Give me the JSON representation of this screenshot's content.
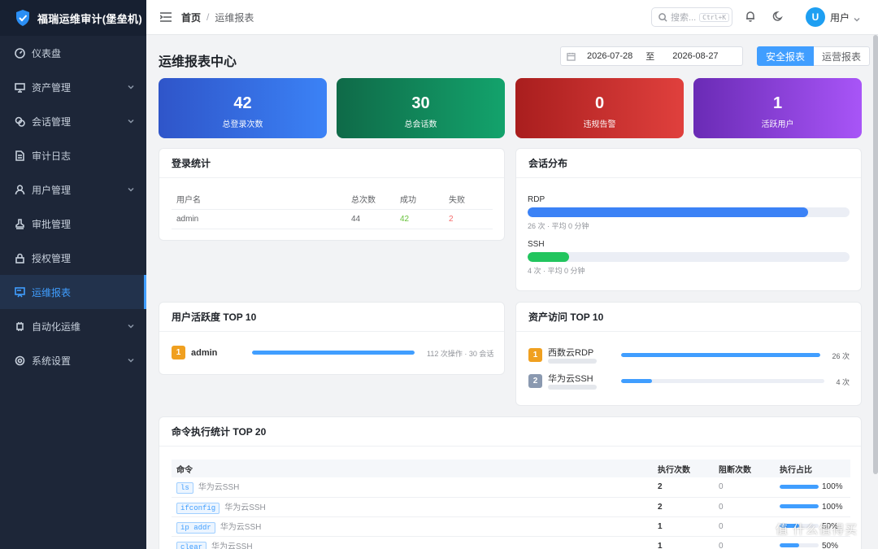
{
  "app": {
    "title": "福瑞运维审计(堡垒机)"
  },
  "sidebar": {
    "items": [
      {
        "label": "仪表盘",
        "icon": "dashboard-icon",
        "expandable": false,
        "active": false
      },
      {
        "label": "资产管理",
        "icon": "monitor-icon",
        "expandable": true,
        "active": false
      },
      {
        "label": "会话管理",
        "icon": "chat-icon",
        "expandable": true,
        "active": false
      },
      {
        "label": "审计日志",
        "icon": "document-icon",
        "expandable": false,
        "active": false
      },
      {
        "label": "用户管理",
        "icon": "user-icon",
        "expandable": true,
        "active": false
      },
      {
        "label": "审批管理",
        "icon": "stamp-icon",
        "expandable": false,
        "active": false
      },
      {
        "label": "授权管理",
        "icon": "lock-icon",
        "expandable": false,
        "active": false
      },
      {
        "label": "运维报表",
        "icon": "report-icon",
        "expandable": false,
        "active": true
      },
      {
        "label": "自动化运维",
        "icon": "chip-icon",
        "expandable": true,
        "active": false
      },
      {
        "label": "系统设置",
        "icon": "gear-icon",
        "expandable": true,
        "active": false
      }
    ]
  },
  "header": {
    "breadcrumb": {
      "home": "首页",
      "sep": "/",
      "current": "运维报表"
    },
    "search": {
      "placeholder": "搜索...",
      "shortcut": "Ctrl+K"
    },
    "user": {
      "avatar_letter": "U",
      "name": "用户"
    }
  },
  "page": {
    "title": "运维报表中心",
    "date_start": "2026-07-28",
    "date_to": "至",
    "date_end": "2026-08-27",
    "tabs": [
      {
        "label": "安全报表",
        "active": true
      },
      {
        "label": "运营报表",
        "active": false
      }
    ]
  },
  "stats": [
    {
      "value": "42",
      "label": "总登录次数",
      "gradient": [
        "#2f55c9",
        "#3b82f6"
      ]
    },
    {
      "value": "30",
      "label": "总会话数",
      "gradient": [
        "#0f6a48",
        "#13a36c"
      ]
    },
    {
      "value": "0",
      "label": "违规告警",
      "gradient": [
        "#a91e1e",
        "#e0403d"
      ]
    },
    {
      "value": "1",
      "label": "活跃用户",
      "gradient": [
        "#6a2bb5",
        "#a855f7"
      ]
    }
  ],
  "login_stats": {
    "title": "登录统计",
    "columns": [
      "用户名",
      "总次数",
      "成功",
      "失败"
    ],
    "rows": [
      {
        "user": "admin",
        "total": "44",
        "success": "42",
        "fail": "2"
      }
    ]
  },
  "session_dist": {
    "title": "会话分布",
    "items": [
      {
        "name": "RDP",
        "fraction": 0.87,
        "color": "#3b82f6",
        "detail": "26 次 · 平均 0 分钟"
      },
      {
        "name": "SSH",
        "fraction": 0.13,
        "color": "#22c55e",
        "detail": "4 次 · 平均 0 分钟"
      }
    ]
  },
  "user_activity": {
    "title": "用户活跃度 TOP 10",
    "items": [
      {
        "rank": "1",
        "name": "admin",
        "fraction": 1.0,
        "detail": "112 次操作 · 30 会话"
      }
    ]
  },
  "asset_access": {
    "title": "资产访问 TOP 10",
    "items": [
      {
        "rank": "1",
        "name": "西数云RDP",
        "fraction": 1.0,
        "count": "26 次",
        "rank_color": "#f0a020"
      },
      {
        "rank": "2",
        "name": "华为云SSH",
        "fraction": 0.15,
        "count": "4 次",
        "rank_color": "#8a99b0"
      }
    ]
  },
  "commands": {
    "title": "命令执行统计 TOP 20",
    "columns": [
      "命令",
      "执行次数",
      "阻断次数",
      "执行占比"
    ],
    "rows": [
      {
        "cmd": "ls",
        "asset": "华为云SSH",
        "count": "2",
        "blocked": "0",
        "fraction": 1.0,
        "pct": "100%"
      },
      {
        "cmd": "ifconfig",
        "asset": "华为云SSH",
        "count": "2",
        "blocked": "0",
        "fraction": 1.0,
        "pct": "100%"
      },
      {
        "cmd": "ip addr",
        "asset": "华为云SSH",
        "count": "1",
        "blocked": "0",
        "fraction": 0.5,
        "pct": "50%"
      },
      {
        "cmd": "clear",
        "asset": "华为云SSH",
        "count": "1",
        "blocked": "0",
        "fraction": 0.5,
        "pct": "50%"
      }
    ]
  },
  "watermark": "值 什么值得买",
  "colors": {
    "accent": "#409eff",
    "sidebar_bg": "#1d2638",
    "success": "#67c23a",
    "danger": "#f56c6c"
  }
}
